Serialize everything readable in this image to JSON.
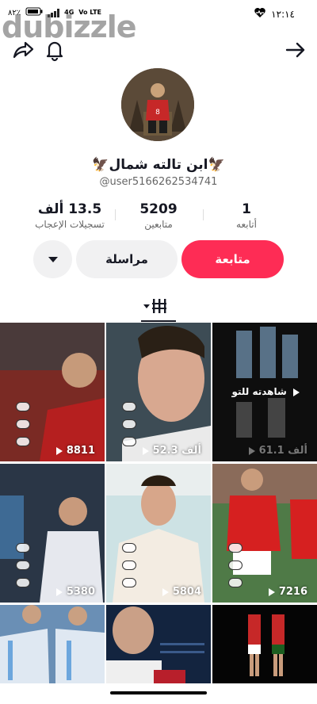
{
  "status_bar": {
    "time": "١٢:١٤",
    "battery": "٨٢٪",
    "network": "4G",
    "volte": "Vo LTE",
    "icons": [
      "heart-rate-icon",
      "signal-icon",
      "battery-icon"
    ]
  },
  "watermark": "dubizzle",
  "nav": {
    "icons": [
      "share-icon",
      "bell-icon",
      "back-arrow-icon"
    ]
  },
  "profile": {
    "display_name": "🦅ابن تالته شمال🦅",
    "handle": "@user5166262534741"
  },
  "stats": [
    {
      "value": "1",
      "label": "أتابعه"
    },
    {
      "value": "5209",
      "label": "متابعين"
    },
    {
      "value": "13.5 ألف",
      "label": "تسجيلات الإعجاب"
    }
  ],
  "actions": {
    "follow": "متابعة",
    "message": "مراسلة"
  },
  "tabs": {
    "icon": "grid-icon"
  },
  "videos": [
    {
      "views": "8811",
      "bg": "#8a2a28"
    },
    {
      "views": "52.3 ألف",
      "bg": "#4a5a63"
    },
    {
      "views": "61.1 ألف",
      "bg": "#141414",
      "watched_label": "شاهدته للتو"
    },
    {
      "views": "5380",
      "bg": "#2c3a4c"
    },
    {
      "views": "5804",
      "bg": "#cfe0e0"
    },
    {
      "views": "7216",
      "bg": "#3a6a3a"
    },
    {
      "views": "",
      "bg": "#4d7fb3"
    },
    {
      "views": "",
      "bg": "#1a2c4a"
    },
    {
      "views": "",
      "bg": "#0a0a0a"
    }
  ],
  "colors": {
    "accent": "#fe2c55",
    "secondary_button": "#f1f1f2"
  }
}
